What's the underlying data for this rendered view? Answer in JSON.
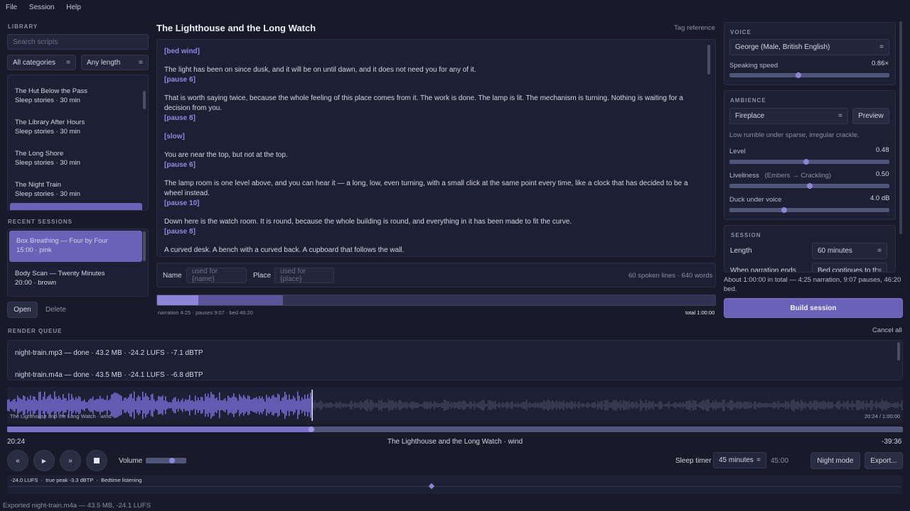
{
  "menu": [
    "File",
    "Session",
    "Help"
  ],
  "library": {
    "label": "LIBRARY",
    "search_placeholder": "Search scripts",
    "category": "All categories",
    "length": "Any length",
    "items": [
      {
        "title": "The Hut Below the Pass",
        "meta": "Sleep stories · 30 min"
      },
      {
        "title": "The Library After Hours",
        "meta": "Sleep stories · 30 min"
      },
      {
        "title": "The Long Shore",
        "meta": "Sleep stories · 30 min"
      },
      {
        "title": "The Night Train",
        "meta": "Sleep stories · 30 min"
      }
    ]
  },
  "recent": {
    "label": "RECENT SESSIONS",
    "items": [
      {
        "title": "Box Breathing — Four by Four",
        "meta": "15:00 · pink"
      },
      {
        "title": "Body Scan — Twenty Minutes",
        "meta": "20:00 · brown"
      }
    ],
    "open": "Open",
    "delete": "Delete"
  },
  "editor": {
    "title": "The Lighthouse and the Long Watch",
    "tag_reference": "Tag reference",
    "blocks": [
      {
        "tag": "[bed wind]",
        "text": "The light has been on since dusk, and it will be on until dawn, and it does not need you for any of it.",
        "after": "[pause 6]"
      },
      {
        "tag": "",
        "text": "That is worth saying twice, because the whole feeling of this place comes from it. The work is done. The lamp is lit. The mechanism is turning. Nothing is waiting for a decision from you.",
        "after": "[pause 8]"
      },
      {
        "tag": "[slow]",
        "text": "You are near the top, but not at the top.",
        "after": "[pause 6]"
      },
      {
        "tag": "",
        "text": "The lamp room is one level above, and you can hear it — a long, low, even turning, with a small click at the same point every time, like a clock that has decided to be a wheel instead.",
        "after": "[pause 10]"
      },
      {
        "tag": "",
        "text": "Down here is the watch room. It is round, because the whole building is round, and everything in it has been made to fit the curve.",
        "after": "[pause 8]"
      },
      {
        "tag": "",
        "text": "A curved desk. A bench with a curved back. A cupboard that follows the wall.",
        "after": ""
      }
    ],
    "name_label": "Name",
    "name_placeholder": "used for {name}",
    "place_label": "Place",
    "place_placeholder": "used for {place}",
    "stats": "60 spoken lines · 640 words"
  },
  "timeline": {
    "narration": "narration 4:25",
    "pauses": "pauses 9:07",
    "bed": "bed 46:20",
    "total": "total 1:00:00",
    "narration_fraction": 0.074,
    "pauses_fraction": 0.152
  },
  "voice": {
    "label": "VOICE",
    "voice": "George (Male, British English)",
    "speed_label": "Speaking speed",
    "speed_value": "0.86×",
    "speed_fraction": 0.43
  },
  "ambience": {
    "label": "AMBIENCE",
    "sound": "Fireplace",
    "preview": "Preview",
    "description": "Low rumble under sparse, irregular crackle.",
    "level_label": "Level",
    "level_value": "0.48",
    "level_fraction": 0.48,
    "liveliness_label": "Liveliness",
    "liveliness_hint": "(Embers → Crackling)",
    "liveliness_value": "0.50",
    "liveliness_fraction": 0.5,
    "duck_label": "Duck under voice",
    "duck_value": "4.0 dB",
    "duck_fraction": 0.34
  },
  "session": {
    "label": "SESSION",
    "length_label": "Length",
    "length": "60 minutes",
    "narration_ends_label": "When narration ends",
    "narration_ends": "Bed continues to the end",
    "summary": "About 1:00:00 in total — 4:25 narration, 9:07 pauses, 46:20 bed.",
    "build": "Build session"
  },
  "queue": {
    "label": "RENDER QUEUE",
    "cancel_all": "Cancel all",
    "items": [
      "night-train.mp3 — done · 43.2 MB · -24.2 LUFS · -7.1 dBTP",
      "night-train.m4a — done · 43.5 MB · -24.1 LUFS · -6.8 dBTP"
    ]
  },
  "player": {
    "wave_caption": "The Lighthouse and the Long Watch · wind",
    "wave_time": "20:24 / 1:00:00",
    "elapsed": "20:24",
    "now_playing": "The Lighthouse and the Long Watch · wind",
    "remaining": "-39:36",
    "progress_fraction": 0.34,
    "volume_label": "Volume",
    "volume_fraction": 0.65,
    "sleep_timer_label": "Sleep timer",
    "sleep_timer": "45 minutes",
    "sleep_remaining": "45:00",
    "night_mode": "Night mode",
    "export": "Export...",
    "loudness": "-24.0 LUFS",
    "true_peak": "true peak -3.3 dBTP",
    "profile": "Bedtime listening",
    "loudness_marker_fraction": 0.47
  },
  "status": "Exported night-train.m4a — 43.5 MB, -24.1 LUFS",
  "colors": {
    "accent": "#6a62b9",
    "accent_light": "#8f86e6",
    "bg": "#181a29"
  }
}
